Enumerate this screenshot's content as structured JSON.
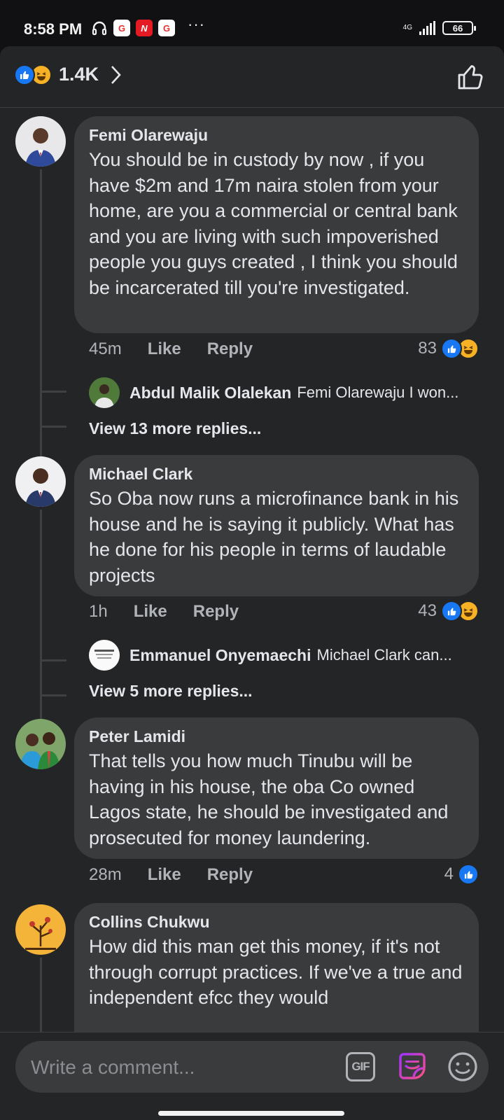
{
  "status_bar": {
    "time": "8:58 PM",
    "notification_icons": [
      "headphones-icon",
      "app-icon",
      "news-icon",
      "app-icon"
    ],
    "more": "···",
    "network": "4G",
    "battery": "66"
  },
  "reactions_header": {
    "count": "1.4K",
    "icons": [
      "like-icon",
      "haha-icon"
    ]
  },
  "comments": [
    {
      "author": "Femi Olarewaju",
      "text": "You should be in custody by now , if you have $2m and 17m naira stolen from your home,  are you a commercial or central bank and you are living with such impoverished people you guys created  , I think you should be incarcerated till you're investigated.",
      "time": "45m",
      "like_label": "Like",
      "reply_label": "Reply",
      "reaction_count": "83",
      "reply_preview": {
        "author": "Abdul Malik Olalekan",
        "text": "Femi Olarewaju I won..."
      },
      "view_more": "View 13 more replies..."
    },
    {
      "author": "Michael Clark",
      "text": "So Oba now runs a microfinance bank in his house and he is saying it publicly. What has he done for his people in terms of laudable projects",
      "time": "1h",
      "like_label": "Like",
      "reply_label": "Reply",
      "reaction_count": "43",
      "reply_preview": {
        "author": "Emmanuel Onyemaechi",
        "text": "Michael Clark can..."
      },
      "view_more": "View 5 more replies..."
    },
    {
      "author": "Peter Lamidi",
      "text": "That tells you how much Tinubu will be having in his house, the oba Co owned Lagos state, he should be investigated and prosecuted for money laundering.",
      "time": "28m",
      "like_label": "Like",
      "reply_label": "Reply",
      "reaction_count": "4"
    },
    {
      "author": "Collins Chukwu",
      "text": "How did this man get this money, if it's not through corrupt practices. If we've a true and independent efcc they would"
    }
  ],
  "composer": {
    "placeholder": "Write a comment...",
    "gif_label": "GIF"
  },
  "colors": {
    "background": "#242526",
    "bubble": "#3a3b3c",
    "like_blue": "#1877f2",
    "haha_yellow": "#f7b125",
    "sticker_gradient": [
      "#a033ff",
      "#ff5280"
    ]
  }
}
